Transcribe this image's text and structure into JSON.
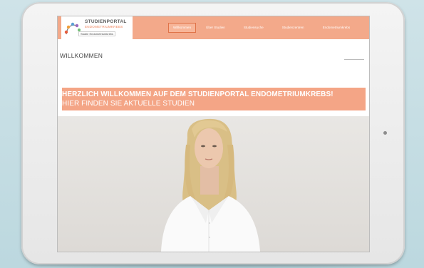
{
  "logo": {
    "title": "STUDIENPORTAL",
    "subtitle": "ENDOMETRIUMKREBS",
    "badge": "Studie Endometriumkrebs"
  },
  "nav": {
    "items": [
      {
        "label": "Willkommen",
        "active": true
      },
      {
        "label": "Über Studien",
        "active": false
      },
      {
        "label": "Studiensuche",
        "active": false
      },
      {
        "label": "Studienzentren",
        "active": false
      },
      {
        "label": "Endometriumkrebs",
        "active": false
      }
    ]
  },
  "page": {
    "title": "WILLKOMMEN"
  },
  "hero": {
    "headline": "HERZLICH WILLKOMMEN AUF DEM STUDIENPORTAL ENDOMETRIUMKREBS!",
    "subline": "HIER FINDEN SIE AKTUELLE STUDIEN"
  },
  "colors": {
    "accent": "#f3a98a",
    "background": "#cfe3e8"
  }
}
